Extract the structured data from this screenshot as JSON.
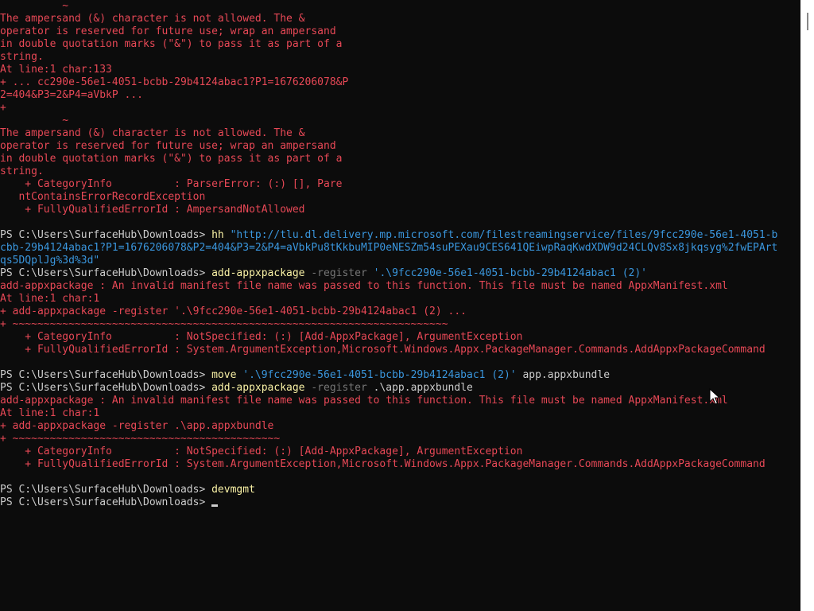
{
  "terminal": {
    "prompt": "PS C:\\Users\\SurfaceHub\\Downloads> ",
    "lines": [
      {
        "segs": [
          {
            "t": "          ~",
            "c": "err"
          }
        ]
      },
      {
        "segs": [
          {
            "t": "The ampersand (&) character is not allowed. The &",
            "c": "err"
          }
        ]
      },
      {
        "segs": [
          {
            "t": "operator is reserved for future use; wrap an ampersand",
            "c": "err"
          }
        ]
      },
      {
        "segs": [
          {
            "t": "in double quotation marks (\"&\") to pass it as part of a",
            "c": "err"
          }
        ]
      },
      {
        "segs": [
          {
            "t": "string.",
            "c": "err"
          }
        ]
      },
      {
        "segs": [
          {
            "t": "At line:1 char:133",
            "c": "err"
          }
        ]
      },
      {
        "segs": [
          {
            "t": "+ ... cc290e-56e1-4051-bcbb-29b4124abac1?P1=1676206078&P",
            "c": "err"
          }
        ]
      },
      {
        "segs": [
          {
            "t": "2=404&P3=2&P4=aVbkP ...",
            "c": "err"
          }
        ]
      },
      {
        "segs": [
          {
            "t": "+",
            "c": "err"
          }
        ]
      },
      {
        "segs": [
          {
            "t": "          ~",
            "c": "err"
          }
        ]
      },
      {
        "segs": [
          {
            "t": "The ampersand (&) character is not allowed. The &",
            "c": "err"
          }
        ]
      },
      {
        "segs": [
          {
            "t": "operator is reserved for future use; wrap an ampersand",
            "c": "err"
          }
        ]
      },
      {
        "segs": [
          {
            "t": "in double quotation marks (\"&\") to pass it as part of a",
            "c": "err"
          }
        ]
      },
      {
        "segs": [
          {
            "t": "string.",
            "c": "err"
          }
        ]
      },
      {
        "segs": [
          {
            "t": "    + CategoryInfo          : ParserError: (:) [], Pare",
            "c": "err"
          }
        ]
      },
      {
        "segs": [
          {
            "t": "   ntContainsErrorRecordException",
            "c": "err"
          }
        ]
      },
      {
        "segs": [
          {
            "t": "    + FullyQualifiedErrorId : AmpersandNotAllowed",
            "c": "err"
          }
        ]
      },
      {
        "segs": []
      },
      {
        "segs": [
          {
            "t": "PS C:\\Users\\SurfaceHub\\Downloads> ",
            "c": "txt"
          },
          {
            "t": "hh",
            "c": "cmd"
          },
          {
            "t": " ",
            "c": "txt"
          },
          {
            "t": "\"http://tlu.dl.delivery.mp.microsoft.com/filestreamingservice/files/9fcc290e-56e1-4051-b",
            "c": "str"
          }
        ]
      },
      {
        "segs": [
          {
            "t": "cbb-29b4124abac1?P1=1676206078&P2=404&P3=2&P4=aVbkPu8tKkbuMIP0eNESZm54suPEXau9CES641QEiwpRaqKwdXDW9d24CLQv8Sx8jkqsyg%2fwEPArt",
            "c": "str"
          }
        ]
      },
      {
        "segs": [
          {
            "t": "qs5DQplJg%3d%3d\"",
            "c": "str"
          }
        ]
      },
      {
        "segs": [
          {
            "t": "PS C:\\Users\\SurfaceHub\\Downloads> ",
            "c": "txt"
          },
          {
            "t": "add-appxpackage",
            "c": "cmd"
          },
          {
            "t": " ",
            "c": "txt"
          },
          {
            "t": "-register",
            "c": "param"
          },
          {
            "t": " ",
            "c": "txt"
          },
          {
            "t": "'.\\9fcc290e-56e1-4051-bcbb-29b4124abac1 (2)'",
            "c": "str"
          }
        ]
      },
      {
        "segs": [
          {
            "t": "add-appxpackage : An invalid manifest file name was passed to this function. This file must be named AppxManifest.xml",
            "c": "err"
          }
        ]
      },
      {
        "segs": [
          {
            "t": "At line:1 char:1",
            "c": "err"
          }
        ]
      },
      {
        "segs": [
          {
            "t": "+ add-appxpackage -register '.\\9fcc290e-56e1-4051-bcbb-29b4124abac1 (2) ...",
            "c": "err"
          }
        ]
      },
      {
        "segs": [
          {
            "t": "+ ~~~~~~~~~~~~~~~~~~~~~~~~~~~~~~~~~~~~~~~~~~~~~~~~~~~~~~~~~~~~~~~~~~~~~~",
            "c": "err"
          }
        ]
      },
      {
        "segs": [
          {
            "t": "    + CategoryInfo          : NotSpecified: (:) [Add-AppxPackage], ArgumentException",
            "c": "err"
          }
        ]
      },
      {
        "segs": [
          {
            "t": "    + FullyQualifiedErrorId : System.ArgumentException,Microsoft.Windows.Appx.PackageManager.Commands.AddAppxPackageCommand",
            "c": "err"
          }
        ]
      },
      {
        "segs": []
      },
      {
        "segs": [
          {
            "t": "PS C:\\Users\\SurfaceHub\\Downloads> ",
            "c": "txt"
          },
          {
            "t": "move",
            "c": "cmd"
          },
          {
            "t": " ",
            "c": "txt"
          },
          {
            "t": "'.\\9fcc290e-56e1-4051-bcbb-29b4124abac1 (2)'",
            "c": "str"
          },
          {
            "t": " app.appxbundle",
            "c": "txt"
          }
        ]
      },
      {
        "segs": [
          {
            "t": "PS C:\\Users\\SurfaceHub\\Downloads> ",
            "c": "txt"
          },
          {
            "t": "add-appxpackage",
            "c": "cmd"
          },
          {
            "t": " ",
            "c": "txt"
          },
          {
            "t": "-register",
            "c": "param"
          },
          {
            "t": " .\\app.appxbundle",
            "c": "txt"
          }
        ]
      },
      {
        "segs": [
          {
            "t": "add-appxpackage : An invalid manifest file name was passed to this function. This file must be named AppxManifest.xml",
            "c": "err"
          }
        ]
      },
      {
        "segs": [
          {
            "t": "At line:1 char:1",
            "c": "err"
          }
        ]
      },
      {
        "segs": [
          {
            "t": "+ add-appxpackage -register .\\app.appxbundle",
            "c": "err"
          }
        ]
      },
      {
        "segs": [
          {
            "t": "+ ~~~~~~~~~~~~~~~~~~~~~~~~~~~~~~~~~~~~~~~~~~~",
            "c": "err"
          }
        ]
      },
      {
        "segs": [
          {
            "t": "    + CategoryInfo          : NotSpecified: (:) [Add-AppxPackage], ArgumentException",
            "c": "err"
          }
        ]
      },
      {
        "segs": [
          {
            "t": "    + FullyQualifiedErrorId : System.ArgumentException,Microsoft.Windows.Appx.PackageManager.Commands.AddAppxPackageCommand",
            "c": "err"
          }
        ]
      },
      {
        "segs": []
      },
      {
        "segs": [
          {
            "t": "PS C:\\Users\\SurfaceHub\\Downloads> ",
            "c": "txt"
          },
          {
            "t": "devmgmt",
            "c": "cmd"
          }
        ]
      },
      {
        "segs": [
          {
            "t": "PS C:\\Users\\SurfaceHub\\Downloads> ",
            "c": "txt"
          }
        ],
        "cursor": true
      }
    ]
  },
  "colors": {
    "background": "#0c0c0c",
    "text": "#cccccc",
    "error": "#e74856",
    "command": "#f9f1a5",
    "parameter": "#767676",
    "string": "#3a96dd",
    "scrollbar": "#ffffff"
  },
  "icons": {
    "cursor": "text-cursor-icon",
    "pointer": "mouse-pointer-icon"
  }
}
